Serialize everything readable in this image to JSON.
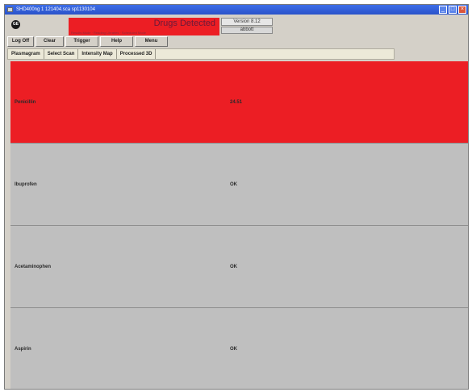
{
  "window": {
    "title": "SHD400ng 1 121404.sca  sp1130104",
    "controls": [
      "minimize",
      "maximize",
      "close"
    ]
  },
  "header": {
    "banner_title": "Drugs Detected",
    "banner_subtitle": "Results Mode · Reading Libraries · Scheduled Mode",
    "version": "Version 8.12",
    "user": "abbott",
    "banner_color": "#ec1e24"
  },
  "toolbar": {
    "log_off": "Log Off",
    "clear": "Clear",
    "trigger": "Trigger",
    "help": "Help",
    "menu": "Menu"
  },
  "tabs": [
    "Plasmagram",
    "Select Scan",
    "Intensity Map",
    "Processed 3D"
  ],
  "results": [
    {
      "name": "Penicillin",
      "status": "24.51",
      "color": "#ec1e24"
    },
    {
      "name": "Ibuprofen",
      "status": "OK",
      "color": "#bfbfbf"
    },
    {
      "name": "Acetaminophen",
      "status": "OK",
      "color": "#bfbfbf"
    },
    {
      "name": "Aspirin",
      "status": "OK",
      "color": "#bfbfbf"
    }
  ]
}
